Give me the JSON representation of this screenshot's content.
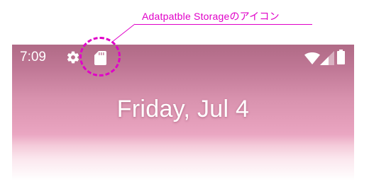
{
  "annotation": {
    "label": "Adatpatble Storageのアイコン",
    "color": "#e000c8"
  },
  "status_bar": {
    "time": "7:09",
    "left_icons": [
      "gear-icon",
      "sd-card-icon"
    ],
    "right_icons": [
      "wifi-icon",
      "signal-icon",
      "battery-icon"
    ]
  },
  "lockscreen": {
    "date": "Friday, Jul 4",
    "wallpaper_colors": [
      "#b06a86",
      "#eaa6c2",
      "#ffffff"
    ]
  }
}
